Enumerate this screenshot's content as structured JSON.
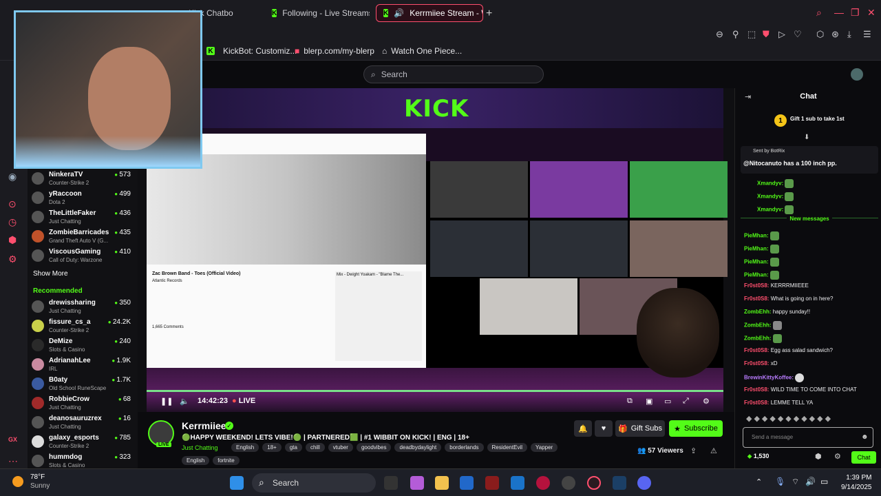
{
  "browser": {
    "tabs": [
      {
        "label": "op - Kick Chatbo",
        "active": false
      },
      {
        "label": "Following - Live Streams",
        "active": false
      },
      {
        "label": "Kerrmiiee Stream - Wa",
        "active": true
      }
    ],
    "bookmarks": [
      "KickBot: Customiz...",
      "blerp.com/my-blerp",
      "Watch One Piece..."
    ],
    "accent": "#ff4f6e"
  },
  "kick": {
    "search_placeholder": "Search",
    "brand_color": "#53fc18",
    "logo_text": "KICK",
    "sidebar": {
      "following": [
        {
          "name": "NinkeraTV",
          "category": "Counter-Strike 2",
          "viewers": "573"
        },
        {
          "name": "yRaccoon",
          "category": "Dota 2",
          "viewers": "499"
        },
        {
          "name": "TheLittleFaker",
          "category": "Just Chatting",
          "viewers": "436"
        },
        {
          "name": "ZombieBarricades",
          "category": "Grand Theft Auto V (G...",
          "viewers": "435"
        },
        {
          "name": "ViscousGaming",
          "category": "Call of Duty: Warzone",
          "viewers": "410"
        }
      ],
      "show_more": "Show More",
      "recommended_heading": "Recommended",
      "recommended": [
        {
          "name": "drewissharing",
          "category": "Just Chatting",
          "viewers": "350"
        },
        {
          "name": "fissure_cs_a",
          "category": "Counter-Strike 2",
          "viewers": "24.2K"
        },
        {
          "name": "DeMize",
          "category": "Slots & Casino",
          "viewers": "240"
        },
        {
          "name": "AdrianahLee",
          "category": "IRL",
          "viewers": "1.9K"
        },
        {
          "name": "B0aty",
          "category": "Old School RuneScape",
          "viewers": "1.7K"
        },
        {
          "name": "RobbieCrow",
          "category": "Just Chatting",
          "viewers": "68"
        },
        {
          "name": "deanosauruzrex",
          "category": "Just Chatting",
          "viewers": "16"
        },
        {
          "name": "galaxy_esports",
          "category": "Counter-Strike 2",
          "viewers": "785"
        },
        {
          "name": "hummdog",
          "category": "Slots & Casino",
          "viewers": "323"
        }
      ]
    },
    "player": {
      "time": "14:42:23",
      "live_label": "LIVE",
      "yt_video_title": "Zac Brown Band - Toes (Official Video)",
      "yt_channel": "Atlantic Records",
      "yt_comments": "1,665 Comments",
      "yt_side_title": "Mix - Dwight Yoakam - \"Blame The..."
    },
    "stream": {
      "streamer": "Kerrmiiee",
      "title": "🟢HAPPY WEEKEND! LETS VIBE!🟢 | PARTNERED🟩 | #1 WIBBIT ON KICK! | ENG | 18+",
      "category": "Just Chatting",
      "tags": [
        "English",
        "18+",
        "gta",
        "chill",
        "vtuber",
        "goodvibes",
        "deadbydaylight",
        "borderlands",
        "ResidentEvil",
        "Yapper"
      ],
      "tags2": [
        "English",
        "fortnite"
      ],
      "viewers": "57 Viewers",
      "live_badge": "LIVE",
      "gift_label": "Gift Subs",
      "subscribe_label": "Subscribe"
    },
    "chat": {
      "header": "Chat",
      "gift_banner": "Gift 1 sub to take 1st",
      "pinned_sender": "Sent by BotRix",
      "pinned_message": "@Nitocanuto has a 100 inch pp.",
      "new_messages": "New messages",
      "messages": [
        {
          "user": "Xmandyv:",
          "text": "",
          "color": "#53fc18"
        },
        {
          "user": "Xmandyv:",
          "text": "",
          "color": "#53fc18"
        },
        {
          "user": "Xmandyv:",
          "text": "",
          "color": "#53fc18"
        },
        {
          "user": "PieMhan:",
          "text": "",
          "color": "#53fc18"
        },
        {
          "user": "PieMhan:",
          "text": "",
          "color": "#53fc18"
        },
        {
          "user": "PieMhan:",
          "text": "",
          "color": "#53fc18"
        },
        {
          "user": "PieMhan:",
          "text": "",
          "color": "#53fc18"
        },
        {
          "user": "Fr0st0S8:",
          "text": "KERRRMIIEEE",
          "color": "#ff4f6e"
        },
        {
          "user": "Fr0st0S8:",
          "text": "What is going on in here?",
          "color": "#ff4f6e"
        },
        {
          "user": "ZombEhh:",
          "text": "happy sunday!!",
          "color": "#53fc18"
        },
        {
          "user": "ZombEhh:",
          "text": "",
          "color": "#53fc18"
        },
        {
          "user": "ZombEhh:",
          "text": "",
          "color": "#53fc18"
        },
        {
          "user": "Fr0st0S8:",
          "text": "Egg ass salad sandwich?",
          "color": "#ff4f6e"
        },
        {
          "user": "Fr0st0S8:",
          "text": "xD",
          "color": "#ff4f6e"
        },
        {
          "user": "BrewinKittyKoffee:",
          "text": "",
          "color": "#b97cff"
        },
        {
          "user": "Fr0st0S8:",
          "text": "WILD TIME TO COME INTO CHAT",
          "color": "#ff4f6e"
        },
        {
          "user": "Fr0st0S8:",
          "text": "LEMME TELL YA",
          "color": "#ff4f6e"
        }
      ],
      "input_placeholder": "Send a message",
      "points": "1,530",
      "send_label": "Chat"
    }
  },
  "taskbar": {
    "temp": "78°F",
    "weather": "Sunny",
    "search_label": "Search",
    "time": "1:39 PM",
    "date": "9/14/2025"
  }
}
